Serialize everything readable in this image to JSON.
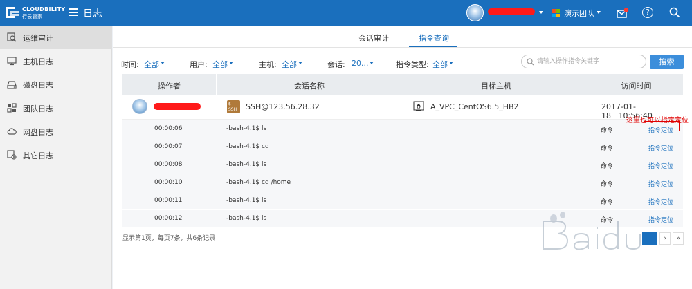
{
  "topbar": {
    "brand": "CLOUDBILITY",
    "brand_sub": "行云管家",
    "app_title": "日志",
    "team_name": "演示团队",
    "colors": {
      "bar": "#1a6fbd",
      "badge": "#ff3b30"
    }
  },
  "sidebar": {
    "items": [
      {
        "label": "运维审计",
        "icon": "audit-icon",
        "active": true
      },
      {
        "label": "主机日志",
        "icon": "monitor-icon",
        "active": false
      },
      {
        "label": "磁盘日志",
        "icon": "disk-icon",
        "active": false
      },
      {
        "label": "团队日志",
        "icon": "team-icon",
        "active": false
      },
      {
        "label": "网盘日志",
        "icon": "cloud-icon",
        "active": false
      },
      {
        "label": "其它日志",
        "icon": "settings-icon",
        "active": false
      }
    ]
  },
  "tabs": [
    {
      "label": "会话审计",
      "active": false
    },
    {
      "label": "指令查询",
      "active": true
    }
  ],
  "filters": {
    "time_label": "时间:",
    "time_value": "全部",
    "user_label": "用户:",
    "user_value": "全部",
    "host_label": "主机:",
    "host_value": "全部",
    "session_label": "会话:",
    "session_value": "20...",
    "cmdtype_label": "指令类型:",
    "cmdtype_value": "全部",
    "search_placeholder": "请输入操作指令关键字",
    "search_button": "搜索"
  },
  "table": {
    "headers": {
      "operator": "操作者",
      "session": "会话名称",
      "host": "目标主机",
      "time": "访问时间"
    },
    "session": {
      "name": "SSH@123.56.28.32",
      "ssh_badge": "SSH",
      "host": "A_VPC_CentOS6.5_HB2",
      "date": "2017-01-18",
      "clock": "10:56:40"
    },
    "commands": [
      {
        "time": "00:00:06",
        "cmd": "-bash-4.1$ ls",
        "type": "命令",
        "link": "指令定位"
      },
      {
        "time": "00:00:07",
        "cmd": "-bash-4.1$ cd",
        "type": "命令",
        "link": "指令定位"
      },
      {
        "time": "00:00:08",
        "cmd": "-bash-4.1$ ls",
        "type": "命令",
        "link": "指令定位"
      },
      {
        "time": "00:00:10",
        "cmd": "-bash-4.1$ cd /home",
        "type": "命令",
        "link": "指令定位"
      },
      {
        "time": "00:00:11",
        "cmd": "-bash-4.1$ ls",
        "type": "命令",
        "link": "指令定位"
      },
      {
        "time": "00:00:12",
        "cmd": "-bash-4.1$ ls",
        "type": "命令",
        "link": "指令定位"
      }
    ]
  },
  "annotation": "这里也可以指定定位",
  "pagination": {
    "info": "显示第1页，每页7条，共6条记录",
    "next": "›",
    "last": "»"
  }
}
